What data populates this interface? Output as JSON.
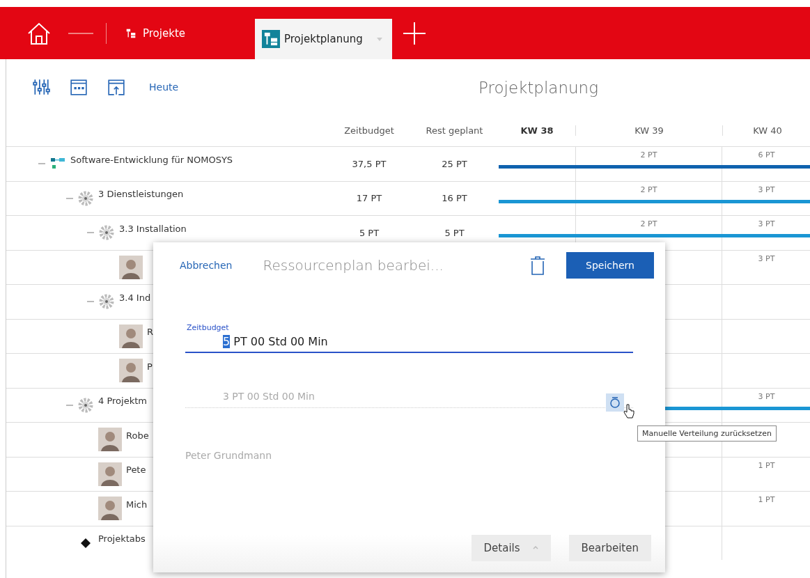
{
  "tabs": [
    {
      "label": "Projekte",
      "kind": "plain",
      "selected": false
    },
    {
      "label": "Projektplanung",
      "kind": "dropdown",
      "selected": true
    }
  ],
  "toolbar": {
    "today_link": "Heute",
    "title": "Projektplanung"
  },
  "columns": {
    "budget": "Zeitbudget",
    "rest": "Rest geplant",
    "weeks": [
      {
        "label": "KW 38",
        "current": true
      },
      {
        "label": "KW 39",
        "current": false
      },
      {
        "label": "KW 40",
        "current": false
      }
    ]
  },
  "tree": [
    {
      "kind": "project",
      "name": "Software-Entwicklung für NOMOSYS",
      "expanded": true,
      "budget": "37,5 PT",
      "rest": "25 PT",
      "kw_39": "2 PT",
      "kw_40": "6 PT",
      "color": "#0f62ae",
      "children": [
        {
          "kind": "phase",
          "name": "3 Dienstleistungen",
          "expanded": true,
          "budget": "17 PT",
          "rest": "16 PT",
          "kw_39": "2 PT",
          "kw_40": "3 PT",
          "color": "#1a96d4",
          "children": [
            {
              "kind": "phase",
              "name": "3.3 Installation",
              "expanded": true,
              "budget": "5 PT",
              "rest": "5 PT",
              "kw_39": "2 PT",
              "kw_40": "3 PT",
              "color": "#1a96d4",
              "children": [
                {
                  "kind": "person",
                  "kw_40": "3 PT"
                }
              ]
            },
            {
              "kind": "phase",
              "name": "3.4 Ind",
              "expanded": true,
              "children": [
                {
                  "kind": "person",
                  "name": "R"
                },
                {
                  "kind": "person",
                  "name": "P"
                }
              ]
            }
          ]
        },
        {
          "kind": "phase",
          "name": "4 Projektm",
          "expanded": true,
          "kw_40": "3 PT",
          "color": "#1a96d4",
          "children": [
            {
              "kind": "person",
              "name": "Robe"
            },
            {
              "kind": "person",
              "name": "Pete",
              "kw_40": "1 PT"
            },
            {
              "kind": "person",
              "name": "Mich",
              "kw_40": "1 PT"
            }
          ]
        },
        {
          "kind": "milestone",
          "name": "Projektabs"
        }
      ]
    }
  ],
  "dialog": {
    "cancel": "Abbrechen",
    "title": "Ressourcenplan bearbei...",
    "save": "Speichern",
    "budget_field": {
      "label": "Zeitbudget",
      "selected_part": "5",
      "rest_part": " PT 00 Std 00 Min"
    },
    "planned_field": {
      "value": "3 PT 00 Std 00 Min",
      "disabled": true
    },
    "tooltip": "Manuelle Verteilung zurücksetzen",
    "person_field": {
      "value": "Peter Grundmann",
      "disabled": true
    },
    "details": "Details",
    "edit": "Bearbeiten"
  }
}
